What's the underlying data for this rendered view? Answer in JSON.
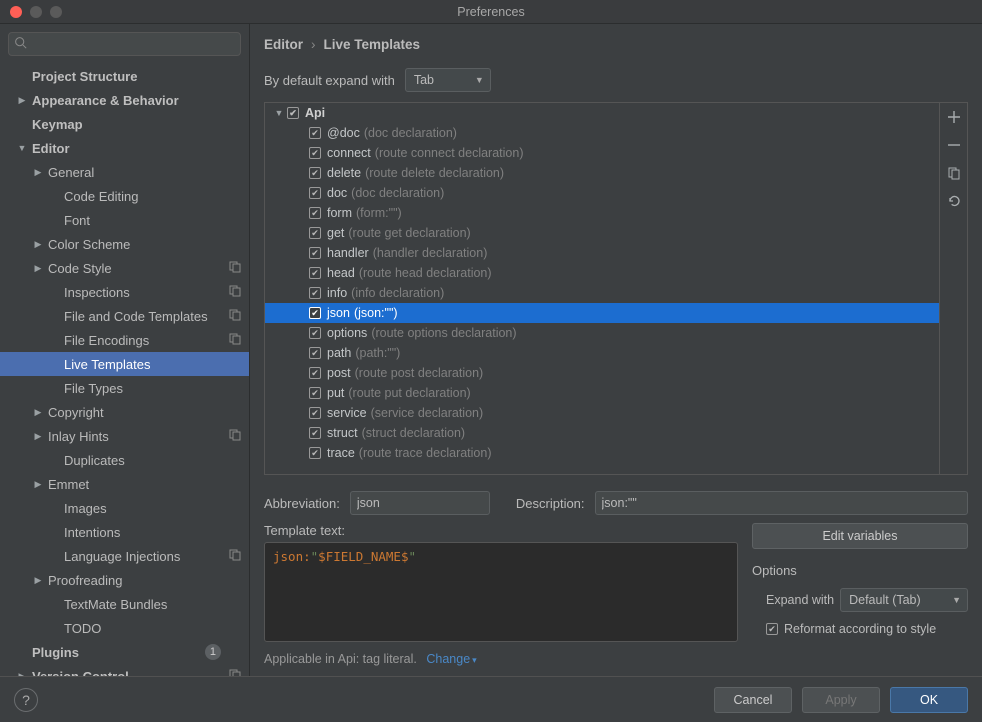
{
  "window": {
    "title": "Preferences"
  },
  "search": {
    "placeholder": ""
  },
  "sidebar": {
    "project_structure": "Project Structure",
    "appearance": "Appearance & Behavior",
    "keymap": "Keymap",
    "editor": "Editor",
    "editor_children": {
      "general": "General",
      "code_editing": "Code Editing",
      "font": "Font",
      "color_scheme": "Color Scheme",
      "code_style": "Code Style",
      "inspections": "Inspections",
      "file_code_templates": "File and Code Templates",
      "file_encodings": "File Encodings",
      "live_templates": "Live Templates",
      "file_types": "File Types",
      "copyright": "Copyright",
      "inlay_hints": "Inlay Hints",
      "duplicates": "Duplicates",
      "emmet": "Emmet",
      "images": "Images",
      "intentions": "Intentions",
      "language_injections": "Language Injections",
      "proofreading": "Proofreading",
      "textmate": "TextMate Bundles",
      "todo": "TODO"
    },
    "plugins": "Plugins",
    "plugins_badge": "1",
    "version_control": "Version Control"
  },
  "breadcrumb": {
    "a": "Editor",
    "b": "Live Templates"
  },
  "expand": {
    "label": "By default expand with",
    "value": "Tab"
  },
  "templates": {
    "group": "Api",
    "items": [
      {
        "name": "@doc",
        "desc": "(doc declaration)"
      },
      {
        "name": "connect",
        "desc": "(route connect declaration)"
      },
      {
        "name": "delete",
        "desc": "(route delete declaration)"
      },
      {
        "name": "doc",
        "desc": "(doc declaration)"
      },
      {
        "name": "form",
        "desc": "(form:\"\")"
      },
      {
        "name": "get",
        "desc": "(route get declaration)"
      },
      {
        "name": "handler",
        "desc": "(handler declaration)"
      },
      {
        "name": "head",
        "desc": "(route head declaration)"
      },
      {
        "name": "info",
        "desc": "(info declaration)"
      },
      {
        "name": "json",
        "desc": "(json:\"\")",
        "selected": true
      },
      {
        "name": "options",
        "desc": "(route options declaration)"
      },
      {
        "name": "path",
        "desc": "(path:\"\")"
      },
      {
        "name": "post",
        "desc": "(route post declaration)"
      },
      {
        "name": "put",
        "desc": "(route put declaration)"
      },
      {
        "name": "service",
        "desc": "(service declaration)"
      },
      {
        "name": "struct",
        "desc": "(struct declaration)"
      },
      {
        "name": "trace",
        "desc": "(route trace declaration)"
      }
    ]
  },
  "details": {
    "abbr_label": "Abbreviation:",
    "abbr_value": "json",
    "desc_label": "Description:",
    "desc_value": "json:\"\"",
    "tpl_text_label": "Template text:",
    "tpl_text_prefix": "json:",
    "tpl_text_open": "\"",
    "tpl_text_var": "$FIELD_NAME$",
    "tpl_text_close": "\"",
    "edit_variables": "Edit variables",
    "options_title": "Options",
    "expand_with_label": "Expand with",
    "expand_with_value": "Default (Tab)",
    "reformat_label": "Reformat according to style"
  },
  "applicable": {
    "text": "Applicable in Api: tag literal.",
    "change": "Change"
  },
  "footer": {
    "cancel": "Cancel",
    "apply": "Apply",
    "ok": "OK"
  }
}
